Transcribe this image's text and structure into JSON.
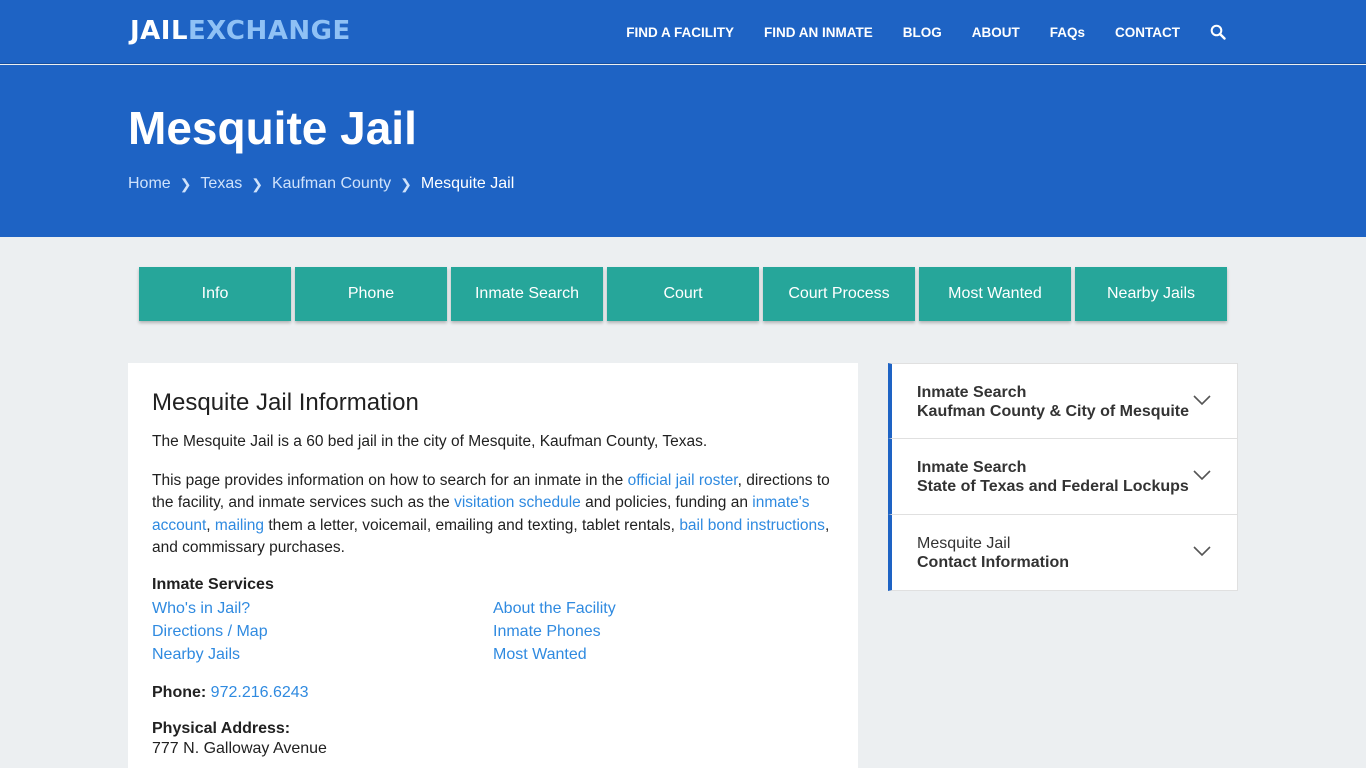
{
  "header": {
    "logo_part1": "JAIL",
    "logo_part2": "EXCHANGE",
    "nav": [
      "FIND A FACILITY",
      "FIND AN INMATE",
      "BLOG",
      "ABOUT",
      "FAQs",
      "CONTACT"
    ],
    "search_icon": "search-icon"
  },
  "hero": {
    "title": "Mesquite Jail",
    "breadcrumb": [
      "Home",
      "Texas",
      "Kaufman County",
      "Mesquite Jail"
    ]
  },
  "tabs": [
    "Info",
    "Phone",
    "Inmate Search",
    "Court",
    "Court Process",
    "Most Wanted",
    "Nearby Jails"
  ],
  "main": {
    "heading": "Mesquite Jail Information",
    "intro": "The Mesquite Jail is a 60 bed jail in the city of Mesquite, Kaufman County, Texas.",
    "para": {
      "t1": "This page provides information on how to search for an inmate in the ",
      "l1": "official jail roster",
      "t2": ", directions to the facility, and inmate services such as the ",
      "l2": "visitation schedule",
      "t3": " and policies, funding an ",
      "l3": "inmate's account",
      "t4": ", ",
      "l4": "mailing",
      "t5": " them a letter, voicemail, emailing and texting, tablet rentals, ",
      "l5": "bail bond instructions",
      "t6": ", and commissary purchases."
    },
    "services_title": "Inmate Services",
    "services": [
      "Who's in Jail?",
      "About the Facility",
      "Directions / Map",
      "Inmate Phones",
      "Nearby Jails",
      "Most Wanted"
    ],
    "phone_label": "Phone:",
    "phone_value": "972.216.6243",
    "address_label": "Physical Address:",
    "address_value": "777 N. Galloway Avenue"
  },
  "sidebar": [
    {
      "line1": "Inmate Search",
      "line2": "Kaufman County & City of Mesquite"
    },
    {
      "line1": "Inmate Search",
      "line2": "State of Texas and Federal Lockups"
    },
    {
      "line1": "Mesquite Jail",
      "line2": "Contact Information"
    }
  ],
  "colors": {
    "primary": "#1e63c4",
    "tab": "#26a69a",
    "link": "#2f8ae0",
    "logo_accent": "#8fc1f5"
  }
}
